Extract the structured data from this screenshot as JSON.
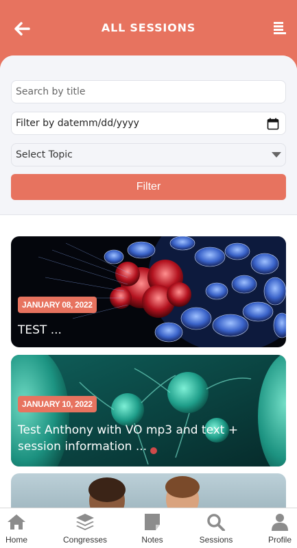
{
  "header": {
    "title": "ALL SESSIONS",
    "back_icon": "arrow-left-icon",
    "menu_icon": "list-menu-icon"
  },
  "filters": {
    "search_placeholder": "Search by title",
    "date_label": "Filter by date",
    "date_value": "mm/dd/yyyy",
    "topic_select": "Select Topic",
    "filter_button": "Filter"
  },
  "sessions": [
    {
      "date": "JANUARY 08, 2022",
      "title": "TEST ...",
      "image": "cells-red-blue"
    },
    {
      "date": "JANUARY 10, 2022",
      "title": "Test Anthony with VO mp3 and text + session information ...",
      "image": "cells-teal"
    },
    {
      "date": "",
      "title": "",
      "image": "children-photo"
    }
  ],
  "tabbar": {
    "items": [
      {
        "label": "Home",
        "icon": "home-icon"
      },
      {
        "label": "Congresses",
        "icon": "layers-icon"
      },
      {
        "label": "Notes",
        "icon": "note-icon"
      },
      {
        "label": "Sessions",
        "icon": "search-icon"
      },
      {
        "label": "Profile",
        "icon": "user-icon"
      }
    ]
  },
  "colors": {
    "accent": "#e7735f",
    "background": "#f4f5f9"
  }
}
